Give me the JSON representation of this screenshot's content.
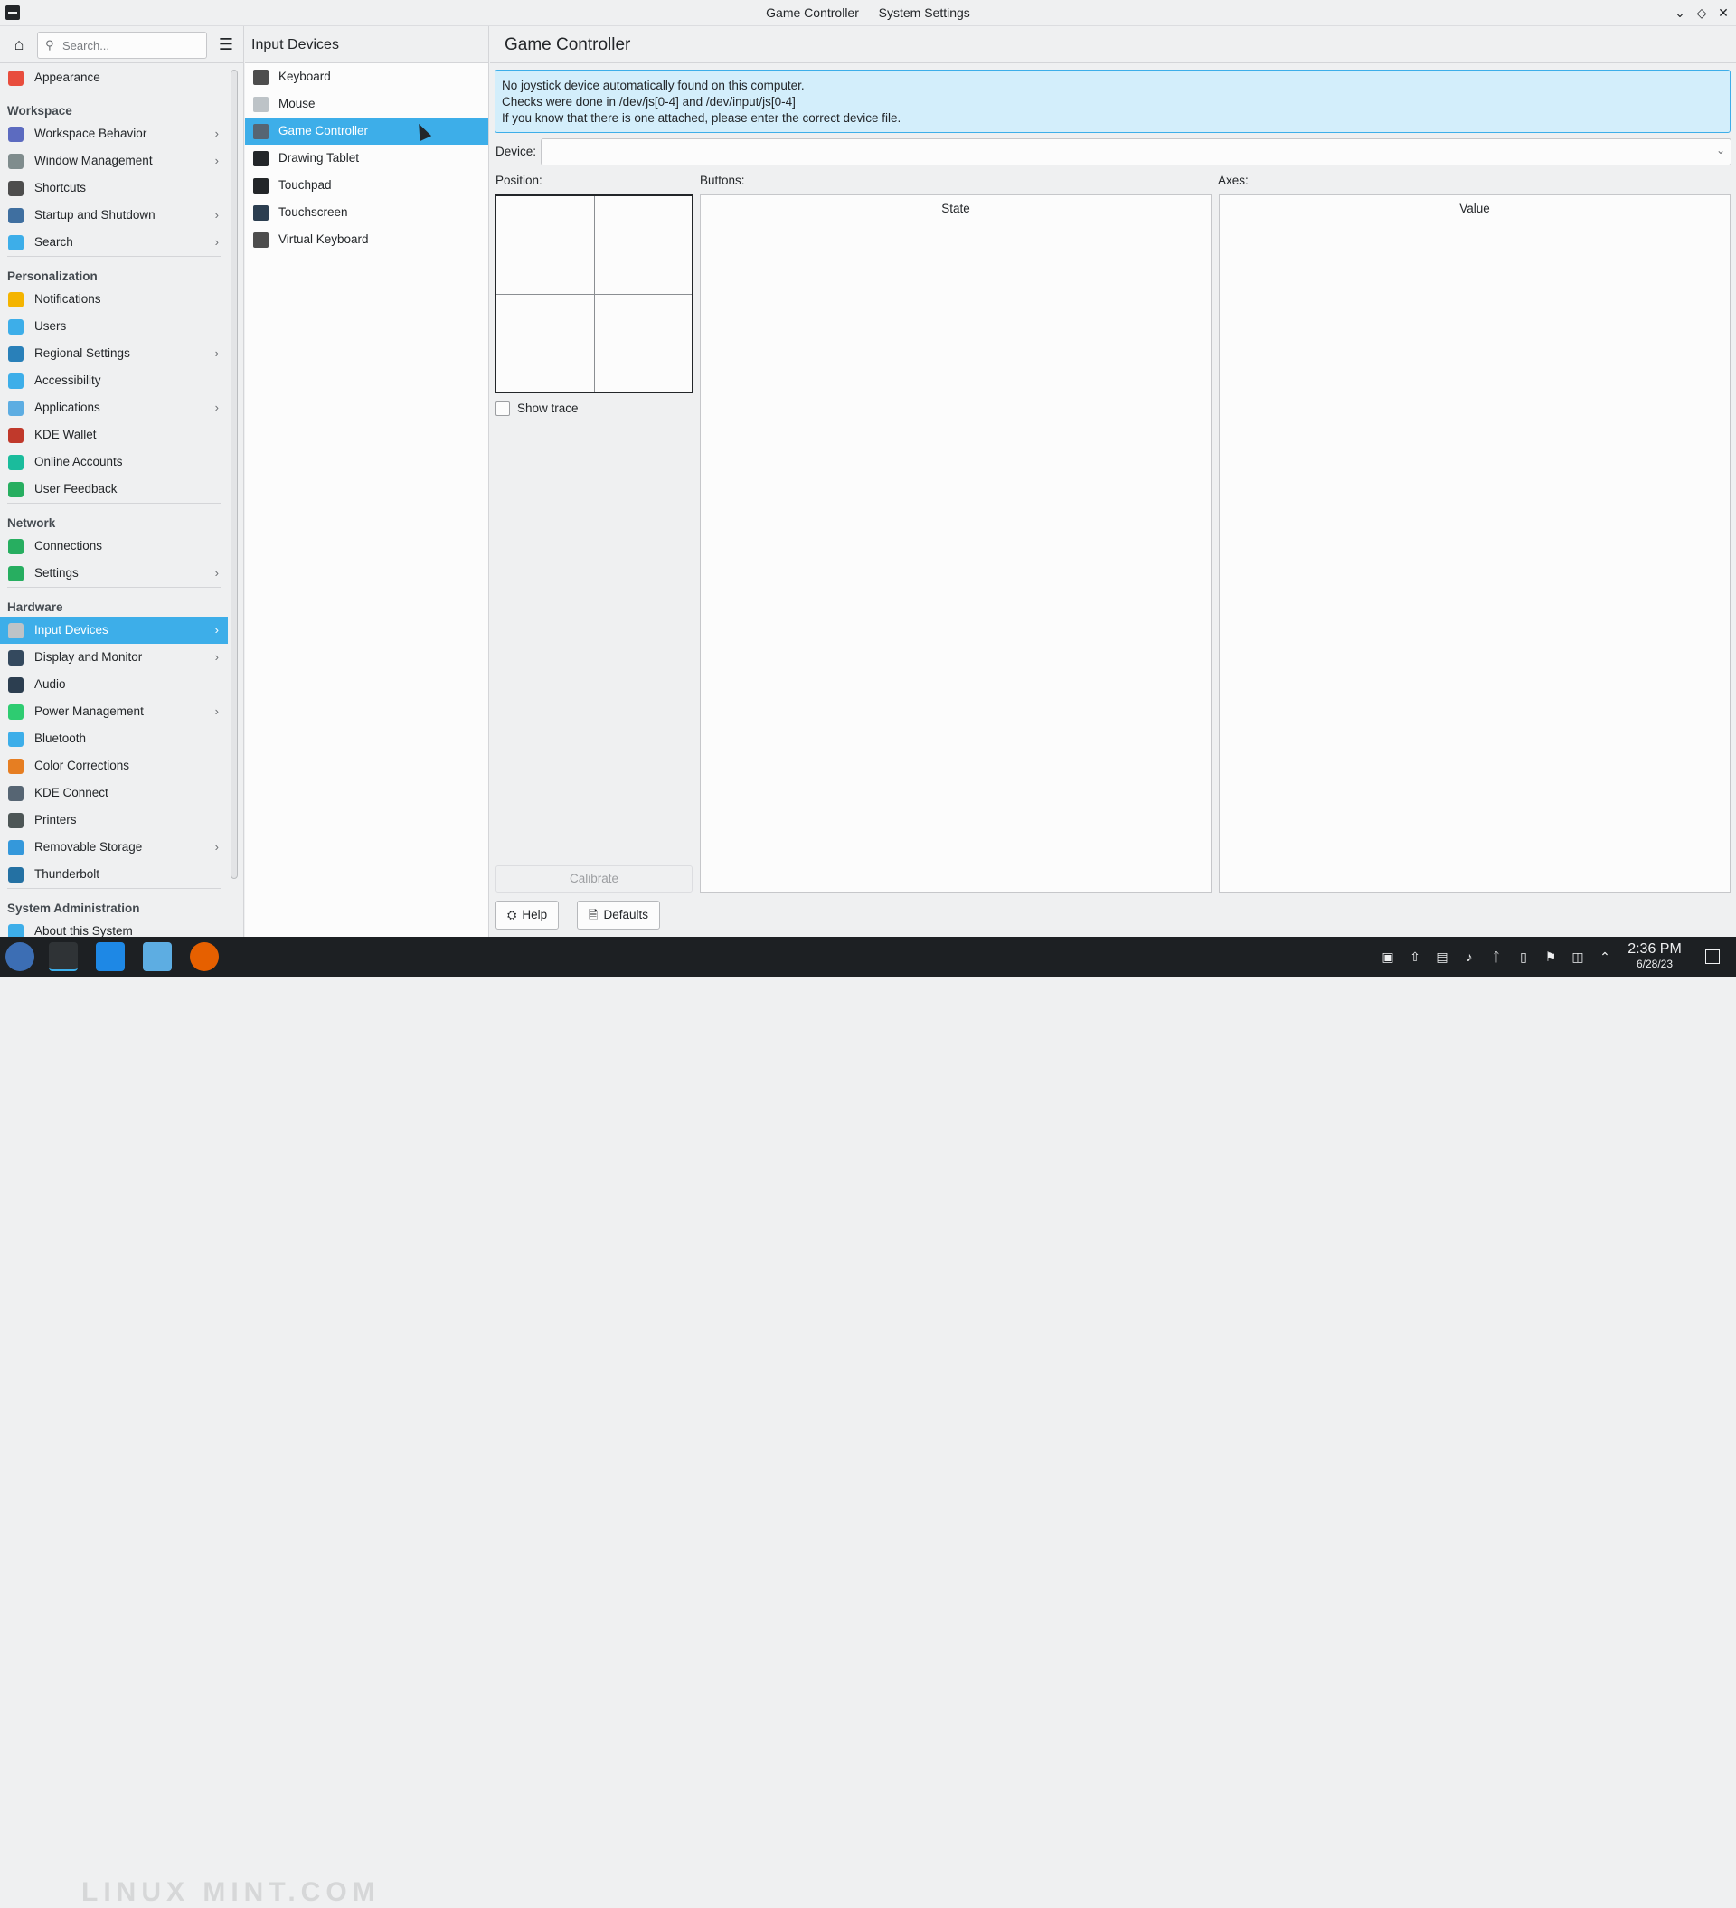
{
  "window": {
    "title": "Game Controller — System Settings"
  },
  "sidebar": {
    "search_placeholder": "Search...",
    "top_item": {
      "label": "Appearance",
      "color": "#e84d3d"
    },
    "sections": [
      {
        "title": "Workspace",
        "items": [
          {
            "label": "Workspace Behavior",
            "chevron": true,
            "color": "#5c6bc0"
          },
          {
            "label": "Window Management",
            "chevron": true,
            "color": "#7f8c8d"
          },
          {
            "label": "Shortcuts",
            "chevron": false,
            "color": "#4d4d4d"
          },
          {
            "label": "Startup and Shutdown",
            "chevron": true,
            "color": "#3f6fa0"
          },
          {
            "label": "Search",
            "chevron": true,
            "color": "#3daee9"
          }
        ]
      },
      {
        "title": "Personalization",
        "items": [
          {
            "label": "Notifications",
            "chevron": false,
            "color": "#f4b400"
          },
          {
            "label": "Users",
            "chevron": false,
            "color": "#3daee9"
          },
          {
            "label": "Regional Settings",
            "chevron": true,
            "color": "#2980b9"
          },
          {
            "label": "Accessibility",
            "chevron": false,
            "color": "#3daee9"
          },
          {
            "label": "Applications",
            "chevron": true,
            "color": "#5dade2"
          },
          {
            "label": "KDE Wallet",
            "chevron": false,
            "color": "#c0392b"
          },
          {
            "label": "Online Accounts",
            "chevron": false,
            "color": "#1abc9c"
          },
          {
            "label": "User Feedback",
            "chevron": false,
            "color": "#27ae60"
          }
        ]
      },
      {
        "title": "Network",
        "items": [
          {
            "label": "Connections",
            "chevron": false,
            "color": "#27ae60"
          },
          {
            "label": "Settings",
            "chevron": true,
            "color": "#27ae60"
          }
        ]
      },
      {
        "title": "Hardware",
        "items": [
          {
            "label": "Input Devices",
            "chevron": true,
            "active": true,
            "color": "#bdc3c7"
          },
          {
            "label": "Display and Monitor",
            "chevron": true,
            "color": "#34495e"
          },
          {
            "label": "Audio",
            "chevron": false,
            "color": "#2c3e50"
          },
          {
            "label": "Power Management",
            "chevron": true,
            "color": "#2ecc71"
          },
          {
            "label": "Bluetooth",
            "chevron": false,
            "color": "#3daee9"
          },
          {
            "label": "Color Corrections",
            "chevron": false,
            "color": "#e67e22"
          },
          {
            "label": "KDE Connect",
            "chevron": false,
            "color": "#566573"
          },
          {
            "label": "Printers",
            "chevron": false,
            "color": "#4d5656"
          },
          {
            "label": "Removable Storage",
            "chevron": true,
            "color": "#3498db"
          },
          {
            "label": "Thunderbolt",
            "chevron": false,
            "color": "#2471a3"
          }
        ]
      },
      {
        "title": "System Administration",
        "items": [
          {
            "label": "About this System",
            "chevron": false,
            "color": "#3daee9"
          }
        ]
      }
    ]
  },
  "middle": {
    "title": "Input Devices",
    "items": [
      {
        "label": "Keyboard",
        "active": false
      },
      {
        "label": "Mouse",
        "active": false
      },
      {
        "label": "Game Controller",
        "active": true
      },
      {
        "label": "Drawing Tablet",
        "active": false
      },
      {
        "label": "Touchpad",
        "active": false
      },
      {
        "label": "Touchscreen",
        "active": false
      },
      {
        "label": "Virtual Keyboard",
        "active": false
      }
    ]
  },
  "main": {
    "title": "Game Controller",
    "info_lines": [
      "No joystick device automatically found on this computer.",
      "Checks were done in /dev/js[0-4] and /dev/input/js[0-4]",
      "If you know that there is one attached, please enter the correct device file."
    ],
    "device_label": "Device:",
    "device_value": "",
    "position_label": "Position:",
    "buttons_label": "Buttons:",
    "axes_label": "Axes:",
    "show_trace_label": "Show trace",
    "buttons_column": "State",
    "axes_column": "Value",
    "calibrate_label": "Calibrate",
    "help_label": "Help",
    "defaults_label": "Defaults"
  },
  "taskbar": {
    "time": "2:36 PM",
    "date": "6/28/23",
    "watermark": "LINUX MINT.COM"
  },
  "colors": {
    "accent": "#3daee9",
    "info_bg": "#d3eefb"
  }
}
